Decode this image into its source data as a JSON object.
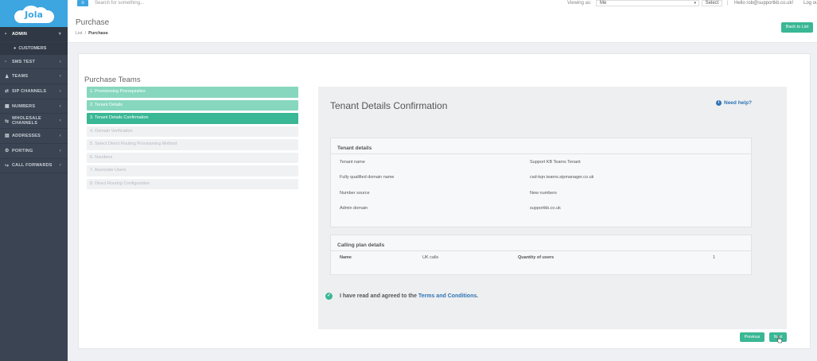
{
  "logo": {
    "text": "Jola"
  },
  "sidebar": {
    "items": [
      {
        "label": "ADMIN",
        "icon": "grid-icon",
        "chevron": "▾",
        "active": true
      },
      {
        "label": "CUSTOMERS",
        "icon": "user-circle-icon",
        "sub": true
      },
      {
        "label": "SMS TEST",
        "icon": "sms-icon",
        "chevron": "‹"
      },
      {
        "label": "TEAMS",
        "icon": "users-icon",
        "chevron": "‹"
      },
      {
        "label": "SIP CHANNELS",
        "icon": "sip-icon",
        "chevron": "‹"
      },
      {
        "label": "NUMBERS",
        "icon": "numbers-icon",
        "chevron": "‹"
      },
      {
        "label": "WHOLESALE CHANNELS",
        "icon": "wholesale-icon",
        "chevron": "‹"
      },
      {
        "label": "ADDRESSES",
        "icon": "address-icon",
        "chevron": "‹"
      },
      {
        "label": "PORTING",
        "icon": "porting-icon",
        "chevron": "‹"
      },
      {
        "label": "CALL FORWARDS",
        "icon": "forward-icon",
        "chevron": "‹"
      }
    ]
  },
  "topbar": {
    "menu_icon": "≡",
    "search_placeholder": "Search for something...",
    "viewing_label": "Viewing as:",
    "viewing_value": "Me",
    "select_label": "Select",
    "divider": "|",
    "hello": "Hello rob@supportkb.co.uk!",
    "logout": "Log out"
  },
  "header": {
    "title": "Purchase",
    "breadcrumb": [
      "List",
      "Purchase"
    ],
    "back_button": "Back to List"
  },
  "wizard": {
    "title": "Purchase Teams",
    "steps": [
      {
        "label": "1. Provisioning Prerequisites",
        "state": "done"
      },
      {
        "label": "2. Tenant Details",
        "state": "done"
      },
      {
        "label": "3. Tenant Details Confirmation",
        "state": "current"
      },
      {
        "label": "4. Domain Verification",
        "state": "todo"
      },
      {
        "label": "5. Select Direct Routing Provisioning Method",
        "state": "todo"
      },
      {
        "label": "6. Numbers",
        "state": "todo"
      },
      {
        "label": "7. Associate Users",
        "state": "todo"
      },
      {
        "label": "8. Direct Routing Configuration",
        "state": "todo"
      }
    ]
  },
  "confirmation": {
    "title": "Tenant Details Confirmation",
    "need_help": "Need help?",
    "tenant_details": {
      "title": "Tenant details",
      "rows": [
        {
          "key": "Tenant name",
          "value": "Support KB Teams Tenant"
        },
        {
          "key": "Fully qualified domain name",
          "value": "csd-kqn.teams.sipmanager.co.uk"
        },
        {
          "key": "Number source",
          "value": "New numbers"
        },
        {
          "key": "Admin domain",
          "value": "supportkb.co.uk"
        }
      ]
    },
    "calling_plan": {
      "title": "Calling plan details",
      "name_label": "Name",
      "name_value": "UK calls",
      "qty_label": "Quantity of users",
      "qty_value": "1"
    },
    "agree_text": "I have read and agreed to the",
    "terms_link": "Terms and Conditions",
    "agree_end": "."
  },
  "buttons": {
    "previous": "Previous",
    "next": "Next"
  },
  "colors": {
    "sidebar_bg": "#3a4452",
    "logo_bg": "#3da5e0",
    "accent_green": "#3ab795",
    "link_blue": "#2f74b5"
  }
}
